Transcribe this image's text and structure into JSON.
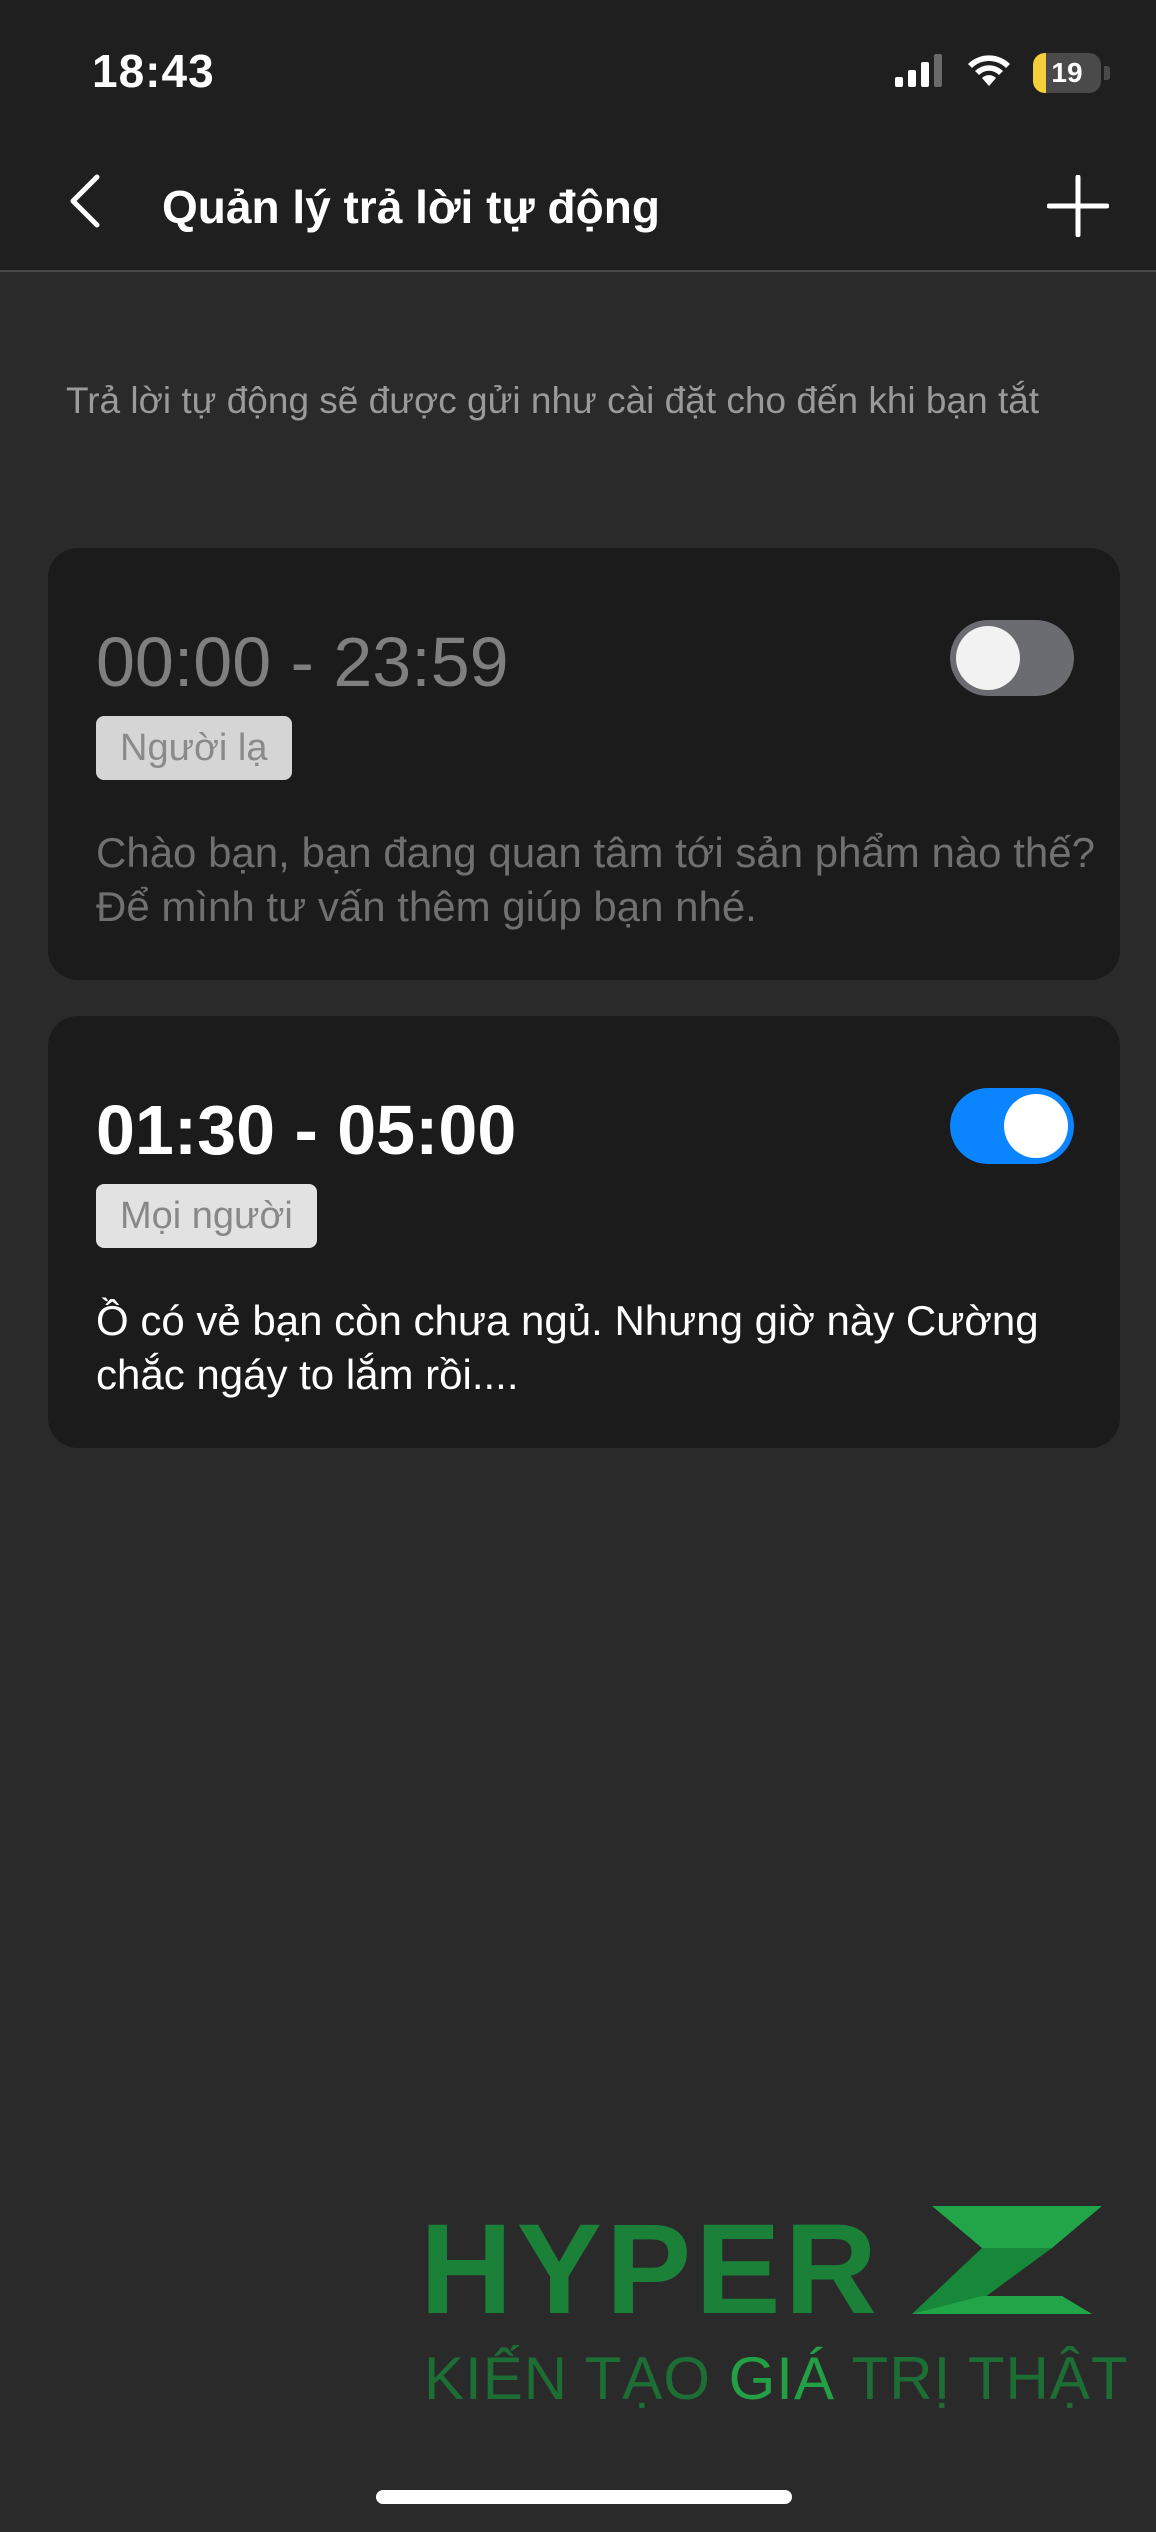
{
  "status_bar": {
    "time": "18:43",
    "battery": "19",
    "battery_level": 0.19,
    "icons": [
      "signal-icon",
      "wifi-icon",
      "battery-icon"
    ]
  },
  "nav": {
    "title": "Quản lý trả lời tự động",
    "back_icon": "chevron-left-icon",
    "add_icon": "plus-icon"
  },
  "description": "Trả lời tự động sẽ được gửi như cài đặt cho đến khi bạn tắt",
  "auto_replies": [
    {
      "time_range": "00:00 - 23:59",
      "audience": "Người lạ",
      "message": "Chào bạn, bạn đang quan tâm tới sản phẩm nào thế? Để mình tư vấn thêm giúp bạn nhé.",
      "enabled": false
    },
    {
      "time_range": "01:30 - 05:00",
      "audience": "Mọi người",
      "message": "Ồ có vẻ bạn còn chưa ngủ. Nhưng giờ này Cường chắc ngáy to lắm rồi....",
      "enabled": true
    }
  ],
  "watermark": {
    "brand_prefix": "HYPER",
    "tagline_part1": "KIẾN TẠO ",
    "tagline_highlight": "GIÁ",
    "tagline_part2": " TRỊ THẬT"
  },
  "colors": {
    "accent": "#0a84ff",
    "toggle_off": "#6b6b72",
    "background": "#2a2a2a",
    "card": "#1b1b1b",
    "watermark_green": "#1a8a3a"
  }
}
